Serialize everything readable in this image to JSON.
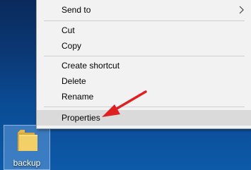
{
  "context_menu": {
    "items": [
      {
        "label": "Send to",
        "has_submenu": true
      },
      {
        "label": "Cut"
      },
      {
        "label": "Copy"
      },
      {
        "label": "Create shortcut"
      },
      {
        "label": "Delete"
      },
      {
        "label": "Rename"
      },
      {
        "label": "Properties",
        "highlighted": true
      }
    ]
  },
  "desktop": {
    "icons": [
      {
        "label": "backup",
        "icon": "folder-icon",
        "selected": true
      }
    ]
  },
  "annotation": {
    "icon": "red-arrow-icon",
    "color": "#e02020"
  }
}
